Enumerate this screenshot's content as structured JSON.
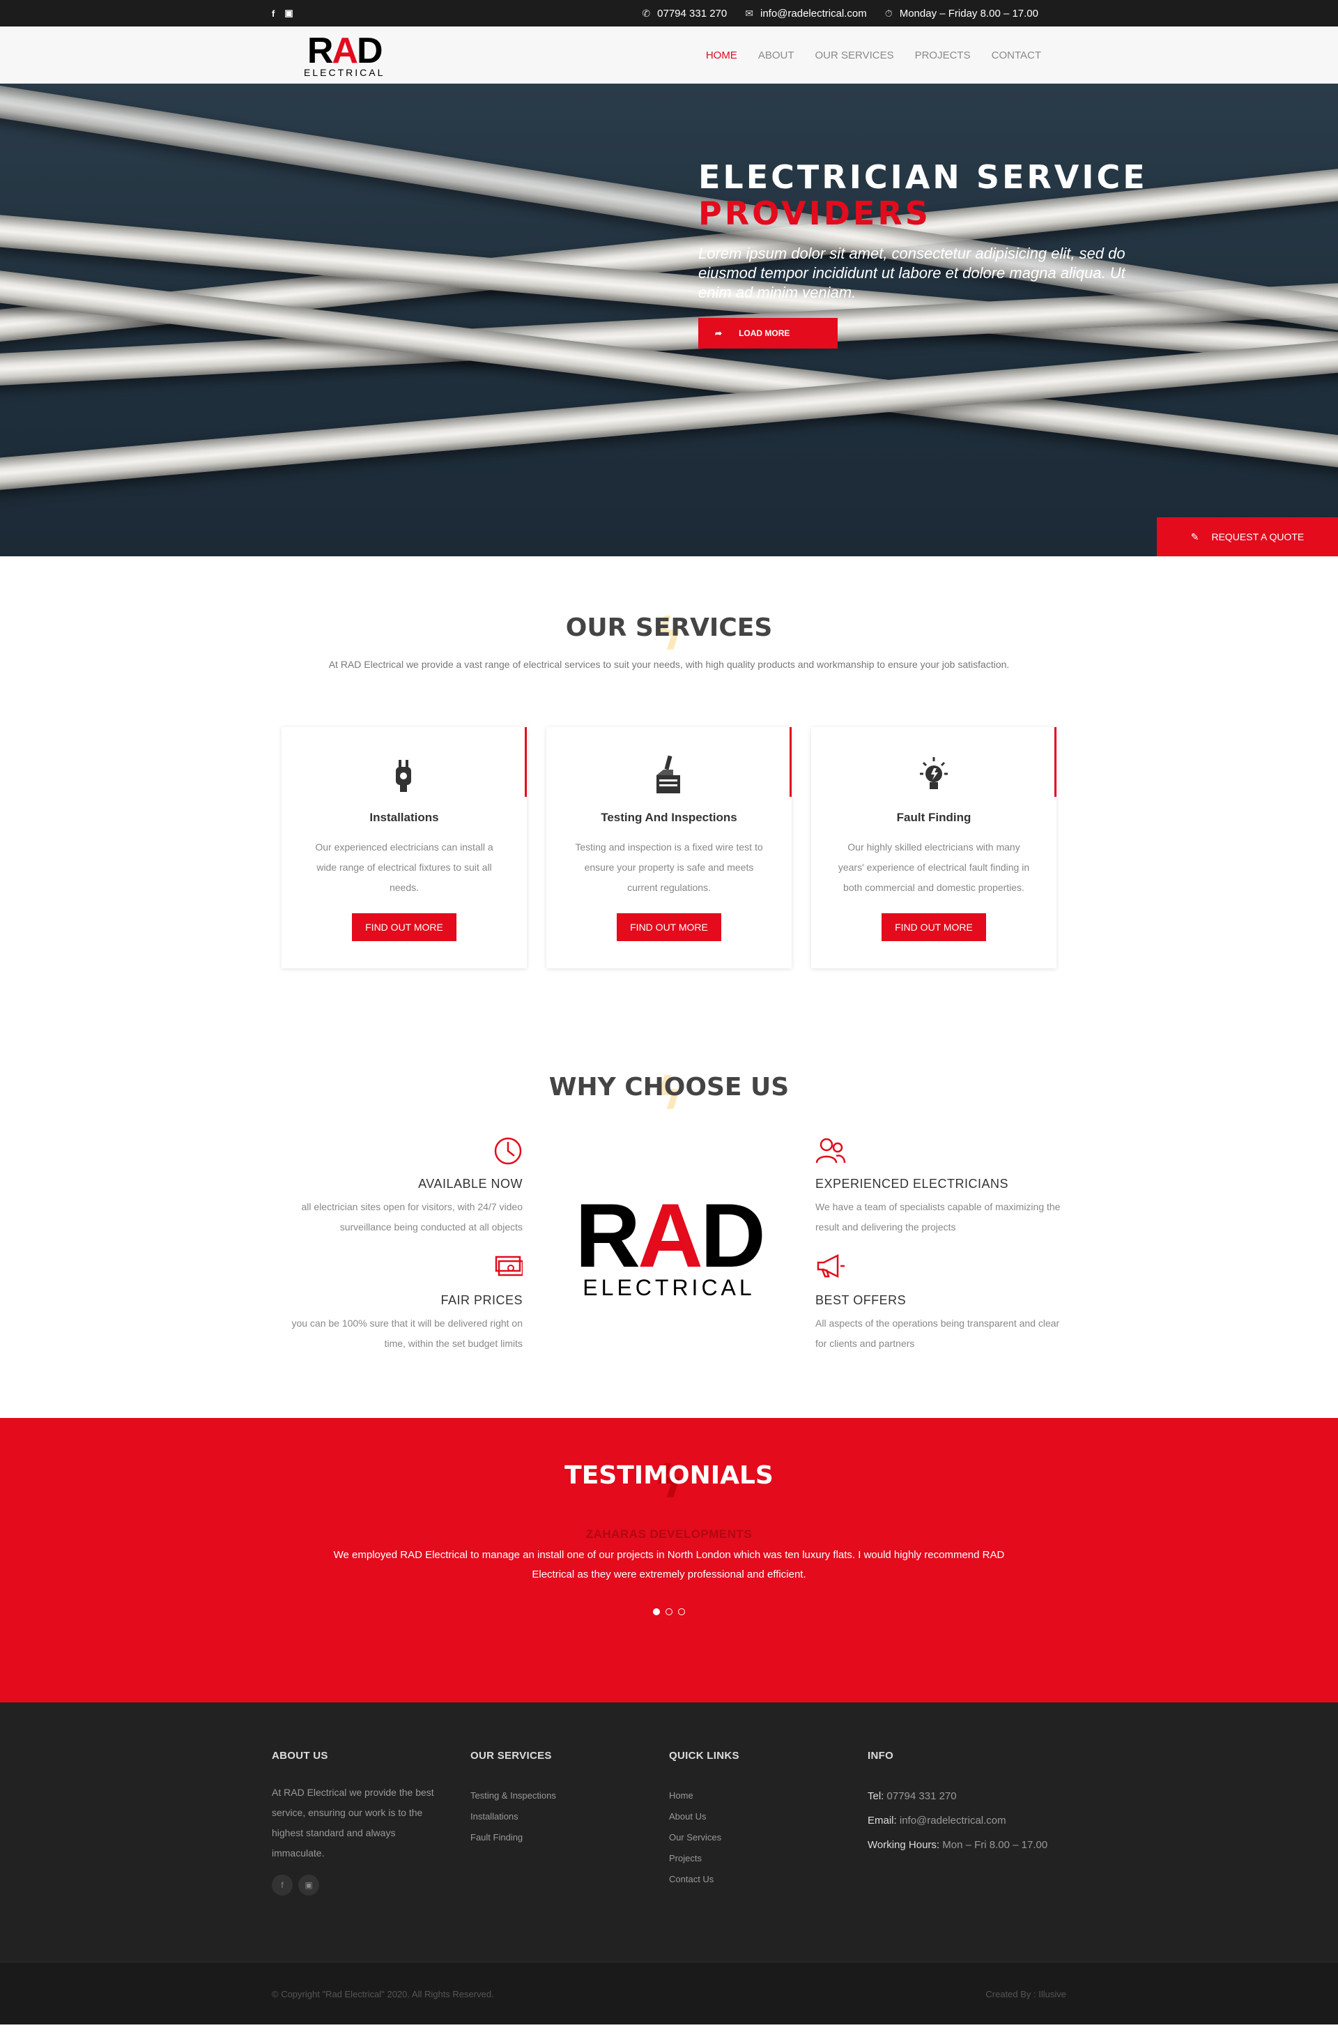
{
  "topbar": {
    "social": [
      "f",
      "ig"
    ],
    "phone": "07794 331 270",
    "email": "info@radelectrical.com",
    "hours": "Monday – Friday 8.00 – 17.00"
  },
  "header": {
    "logo_rad": "RAD",
    "logo_electrical": "ELECTRICAL",
    "nav": [
      "HOME",
      "ABOUT",
      "OUR SERVICES",
      "PROJECTS",
      "CONTACT"
    ]
  },
  "hero": {
    "title_line1": "ELECTRICIAN SERVICE",
    "title_line2": "PROVIDERS",
    "subtitle": "Lorem ipsum dolor sit amet, consectetur adipisicing elit, sed do eiusmod tempor incididunt ut labore et dolore magna aliqua. Ut enim ad minim veniam.",
    "button": "LOAD MORE",
    "quote_button": "REQUEST A QUOTE"
  },
  "services": {
    "title": "OUR SERVICES",
    "intro": "At RAD Electrical we provide a vast range of electrical services to suit your needs, with high quality products and workmanship to ensure your job satisfaction.",
    "cards": [
      {
        "icon": "plug-icon",
        "title": "Installations",
        "text": "Our experienced electricians can install a wide range of electrical fixtures to suit all needs.",
        "button": "FIND OUT MORE"
      },
      {
        "icon": "hand-tester-icon",
        "title": "Testing And Inspections",
        "text": "Testing and inspection is a fixed wire test to ensure your property is safe and meets current regulations.",
        "button": "FIND OUT MORE"
      },
      {
        "icon": "lightbulb-icon",
        "title": "Fault Finding",
        "text": "Our highly skilled electricians with many years' experience of electrical fault finding in both commercial and domestic properties.",
        "button": "FIND OUT MORE"
      }
    ]
  },
  "why": {
    "title": "WHY CHOOSE US",
    "left": [
      {
        "icon": "clock-icon",
        "title": "AVAILABLE NOW",
        "text": "all electrician sites open for visitors, with 24/7 video surveillance being conducted at all objects"
      },
      {
        "icon": "money-icon",
        "title": "FAIR PRICES",
        "text": "you can be 100% sure that it will be delivered right on time, within the set budget limits"
      }
    ],
    "right": [
      {
        "icon": "users-icon",
        "title": "EXPERIENCED ELECTRICIANS",
        "text": "We have a team of specialists capable of maximizing the result and delivering the projects"
      },
      {
        "icon": "megaphone-icon",
        "title": "BEST OFFERS",
        "text": "All aspects of the operations being transparent and clear for clients and partners"
      }
    ]
  },
  "testimonials": {
    "title": "TESTIMONIALS",
    "author": "ZAHARAS DEVELOPMENTS",
    "text": "We employed RAD Electrical to manage an install one of our projects in North London which was ten luxury flats. I would highly recommend RAD Electrical as they were extremely professional and efficient."
  },
  "footer": {
    "about_title": "ABOUT US",
    "about_text": "At RAD Electrical we provide the best service, ensuring our work is to the highest standard and always immaculate.",
    "services_title": "OUR SERVICES",
    "services": [
      "Testing & Inspections",
      "Installations",
      "Fault Finding"
    ],
    "links_title": "QUICK LINKS",
    "links": [
      "Home",
      "About Us",
      "Our Services",
      "Projects",
      "Contact Us"
    ],
    "info_title": "INFO",
    "tel_label": "Tel:",
    "tel": "07794 331 270",
    "email_label": "Email:",
    "email": "info@radelectrical.com",
    "hours_label": "Working Hours:",
    "hours": "Mon – Fri 8.00 – 17.00"
  },
  "bottom": {
    "copyright": "© Copyright \"Rad Electrical\" 2020. All Rights Reserved.",
    "credit": "Created By : Illusive"
  },
  "colors": {
    "accent": "#e30b1c",
    "dark": "#1c1c1c"
  }
}
